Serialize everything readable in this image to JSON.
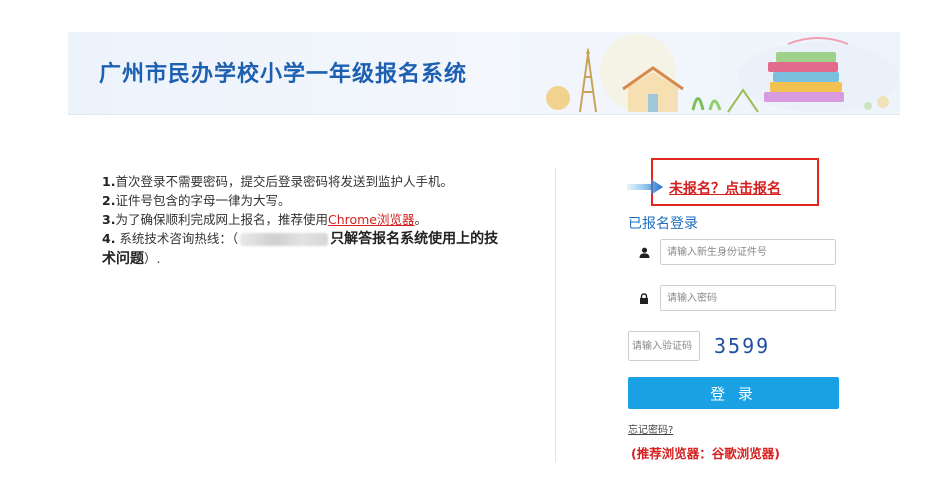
{
  "banner": {
    "title": "广州市民办学校小学一年级报名系统"
  },
  "notes": {
    "line1_num": "1.",
    "line1_text": "首次登录不需要密码，提交后登录密码将发送到监护人手机。",
    "line2_num": "2.",
    "line2_text": "证件号包含的字母一律为大写。",
    "line3_num": "3.",
    "line3_text": "为了确保顺利完成网上报名，推荐使用",
    "line3_link": "Chrome浏览器",
    "line3_end": "。",
    "line4_num": "4.",
    "line4_text": " 系统技术咨询热线：（",
    "line4_bold": "只解答报名系统使用上的技术问题",
    "line4_end": "）."
  },
  "register": {
    "link_label": "未报名？点击报名"
  },
  "login": {
    "heading": "已报名登录",
    "id_placeholder": "请输入新生身份证件号",
    "password_placeholder": "请输入密码",
    "captcha_placeholder": "请输入验证码",
    "captcha_code": "3599",
    "submit_label": "登 录",
    "forgot_label": "忘记密码?",
    "recommend_text": "(推荐浏览器：谷歌浏览器)"
  },
  "colors": {
    "title_blue": "#1d5fb0",
    "link_red": "#d61f1f",
    "button_blue": "#1aa1e3",
    "highlight_border": "#e0281f"
  },
  "icons": {
    "id_field": "user-icon",
    "password_field": "lock-icon",
    "register_pointer": "arrow-right-icon"
  }
}
